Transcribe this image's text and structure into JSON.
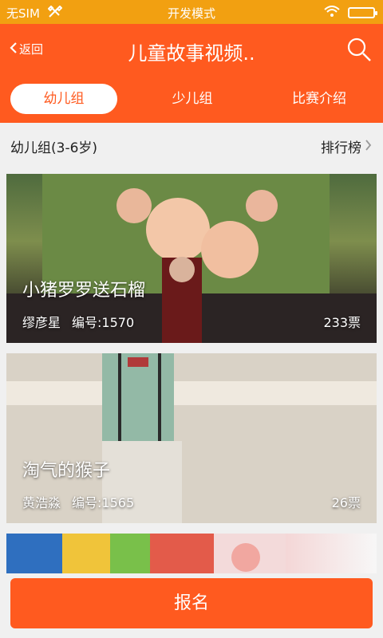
{
  "status_bar": {
    "carrier": "无SIM",
    "mode": "开发模式"
  },
  "nav": {
    "back_label": "返回",
    "title": "儿童故事视频.."
  },
  "tabs": [
    {
      "label": "幼儿组"
    },
    {
      "label": "少儿组"
    },
    {
      "label": "比赛介绍"
    }
  ],
  "section": {
    "title": "幼儿组(3-6岁)",
    "ranking_label": "排行榜"
  },
  "cards": [
    {
      "title": "小猪罗罗送石榴",
      "author": "缪彦星",
      "number": "编号:1570",
      "votes": "233票"
    },
    {
      "title": "淘气的猴子",
      "author": "黄浩淼",
      "number": "编号:1565",
      "votes": "26票"
    }
  ],
  "signup_label": "报名",
  "colors": {
    "status_bar": "#f2a011",
    "accent": "#ff5a1f"
  }
}
